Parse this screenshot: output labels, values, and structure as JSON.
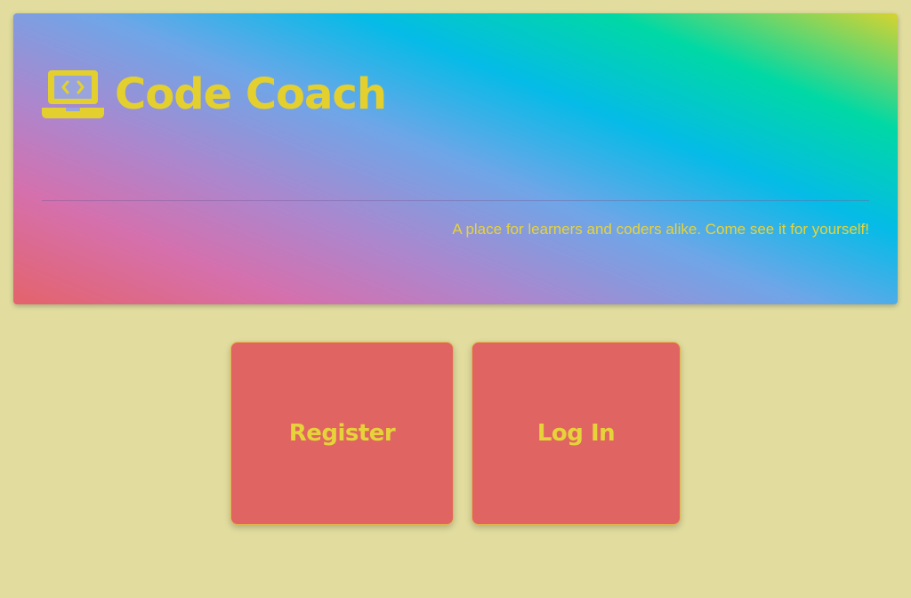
{
  "brand": {
    "title": "Code Coach",
    "icon": "laptop-code-icon"
  },
  "tagline": "A place for learners and coders alike. Come see it for yourself!",
  "actions": {
    "register_label": "Register",
    "login_label": "Log In"
  },
  "colors": {
    "page_background": "#e2dd9f",
    "accent_yellow": "#e3d02e",
    "card_red": "#e06461",
    "card_border": "#e3b84c"
  }
}
